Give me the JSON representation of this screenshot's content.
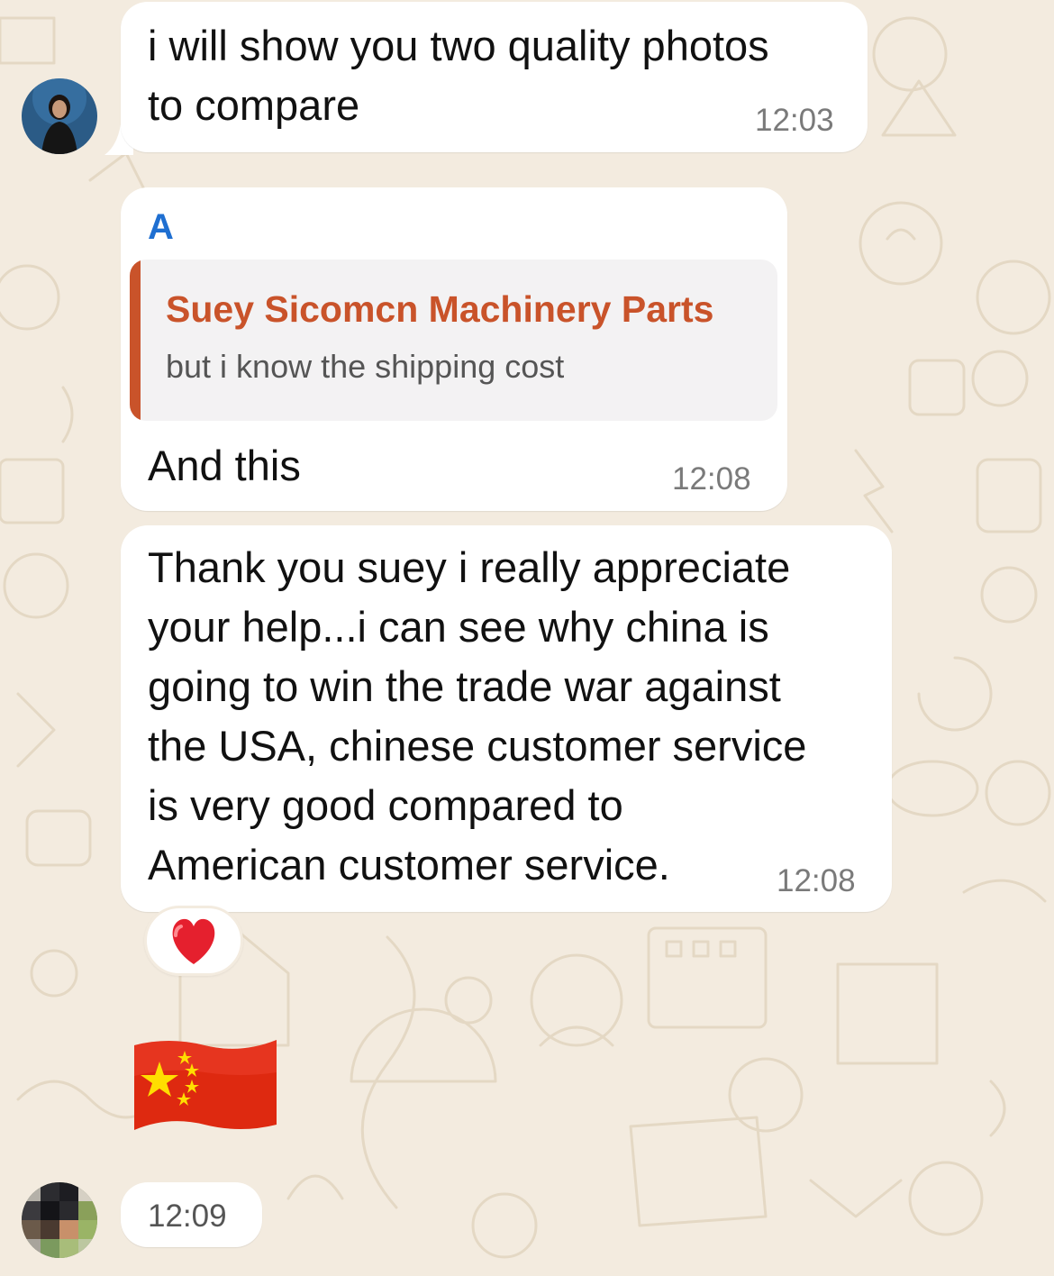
{
  "messages": [
    {
      "text": "i will show you two quality photos to compare",
      "line1": "i will show you two quality photos",
      "line2": "to compare",
      "time": "12:03"
    },
    {
      "sender": "A",
      "quote_author": "Suey Sicomcn Machinery Parts",
      "quote_text": "but i know the shipping cost",
      "text": "And this",
      "time": "12:08"
    },
    {
      "lines": [
        "Thank you suey i really appreciate",
        "your help...i can see why china is",
        "going to win the trade war against",
        "the USA, chinese customer service",
        "is very good compared to",
        "American customer service."
      ],
      "time": "12:08",
      "reaction": "❤️"
    },
    {
      "sticker": "China flag",
      "time": "12:09"
    }
  ],
  "colors": {
    "background": "#f3ebdf",
    "sender_name": "#1f6fd1",
    "quote_accent": "#c9532a",
    "flag_red": "#de2910",
    "flag_star": "#ffde00"
  }
}
